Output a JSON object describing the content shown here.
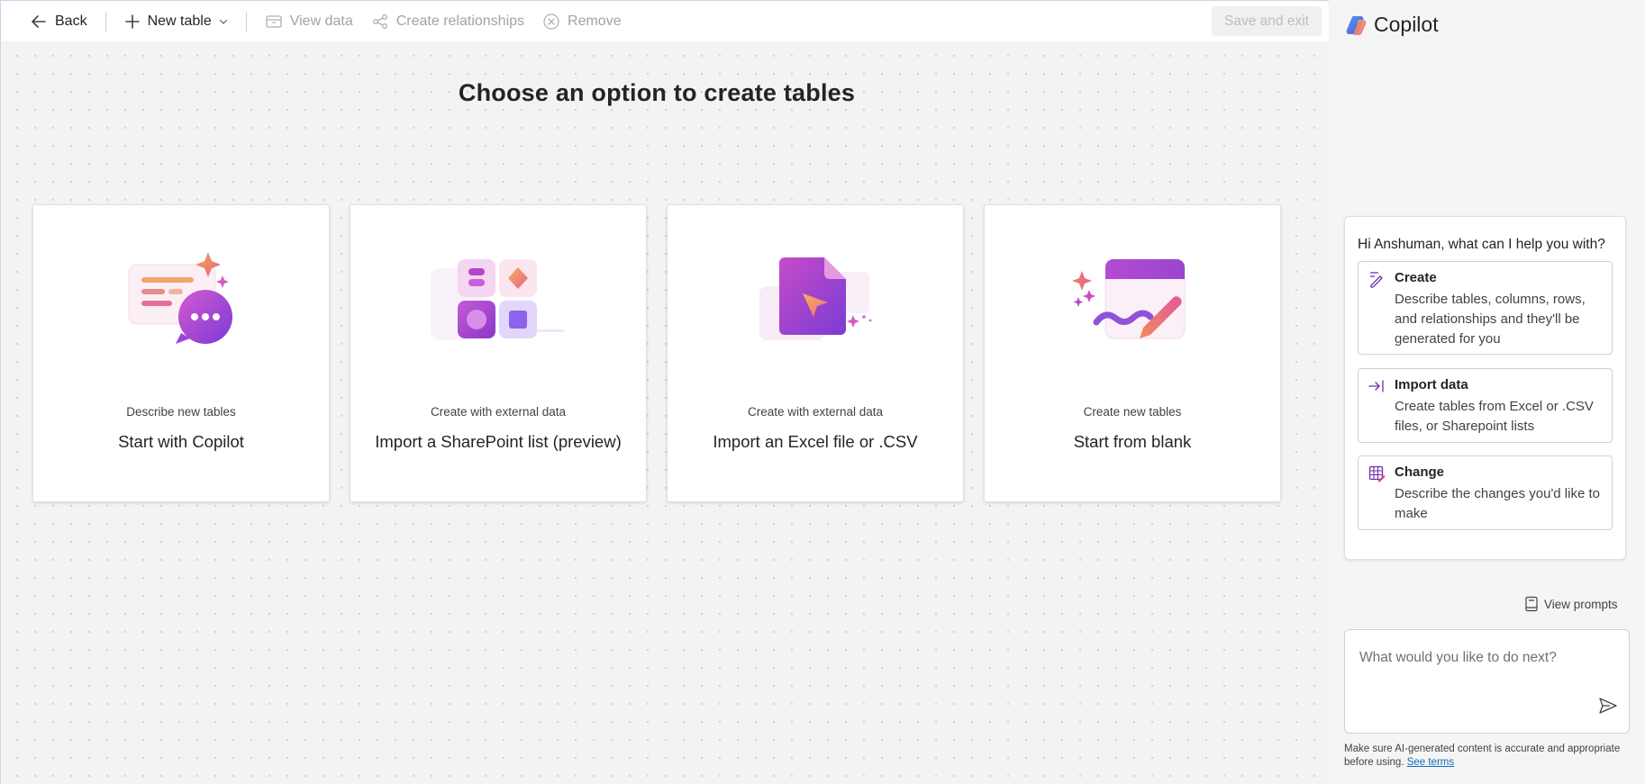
{
  "toolbar": {
    "back_label": "Back",
    "new_table_label": "New table",
    "view_data_label": "View data",
    "create_relationships_label": "Create relationships",
    "remove_label": "Remove",
    "save_exit_label": "Save and exit"
  },
  "main": {
    "title": "Choose an option to create tables",
    "cards": [
      {
        "subtitle": "Describe new tables",
        "title": "Start with Copilot"
      },
      {
        "subtitle": "Create with external data",
        "title": "Import a SharePoint list (preview)"
      },
      {
        "subtitle": "Create with external data",
        "title": "Import an Excel file or .CSV"
      },
      {
        "subtitle": "Create new tables",
        "title": "Start from blank"
      }
    ]
  },
  "copilot": {
    "title": "Copilot",
    "greeting": "Hi Anshuman, what can I help you with?",
    "options": [
      {
        "title": "Create",
        "description": "Describe tables, columns, rows, and relationships and they'll be generated for you"
      },
      {
        "title": "Import data",
        "description": "Create tables from Excel or .CSV files, or Sharepoint lists"
      },
      {
        "title": "Change",
        "description": "Describe the changes you'd like to make"
      }
    ],
    "view_prompts_label": "View prompts",
    "input_placeholder": "What would you like to do next?",
    "disclaimer_text": "Make sure AI-generated content is accurate and appropriate before using.",
    "see_terms_label": "See terms"
  },
  "colors": {
    "accent": "#0f6cbd",
    "canvas_bg": "#f4f3f2",
    "panel_bg": "#f5f5f5",
    "illustration_purple": "#8a3fd1",
    "illustration_orange": "#f08a5d"
  },
  "icons": [
    "back-arrow-icon",
    "plus-icon",
    "chevron-down-icon",
    "view-data-icon",
    "relationships-icon",
    "remove-icon",
    "copilot-logo-icon",
    "create-pen-icon",
    "import-arrow-icon",
    "change-table-icon",
    "prompts-book-icon",
    "send-icon"
  ]
}
